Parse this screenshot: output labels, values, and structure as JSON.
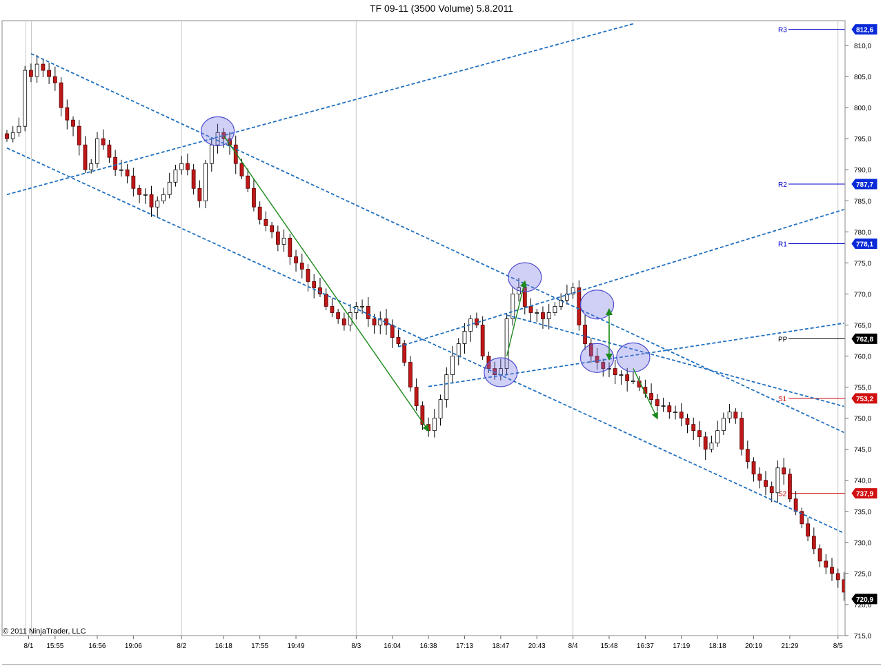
{
  "chart_data": {
    "type": "candlestick",
    "title": "TF 09-11 (3500 Volume)  5.8.2011",
    "copyright": "© 2011 NinjaTrader, LLC",
    "ylim": [
      715,
      814
    ],
    "y_ticks": [
      "715,0",
      "720,0",
      "725,0",
      "730,0",
      "735,0",
      "740,0",
      "745,0",
      "750,0",
      "755,0",
      "760,0",
      "765,0",
      "770,0",
      "775,0",
      "780,0",
      "785,0",
      "790,0",
      "795,0",
      "800,0",
      "805,0",
      "810,0"
    ],
    "y_tick_values": [
      715,
      720,
      725,
      730,
      735,
      740,
      745,
      750,
      755,
      760,
      765,
      770,
      775,
      780,
      785,
      790,
      795,
      800,
      805,
      810
    ],
    "x_labels": [
      "8/1",
      "15:55",
      "16:56",
      "19:06",
      "8/2",
      "16:18",
      "17:55",
      "19:49",
      "8/3",
      "16:04",
      "16:38",
      "17:13",
      "18:47",
      "20:43",
      "8/4",
      "15:48",
      "16:37",
      "17:19",
      "18:18",
      "20:19",
      "21:29",
      "8/5"
    ],
    "x_label_bars": [
      2,
      8,
      15,
      21,
      29,
      36,
      42,
      48,
      58,
      64,
      70,
      76,
      82,
      88,
      94,
      100,
      106,
      112,
      118,
      124,
      130,
      138
    ],
    "session_breaks": [
      2,
      29,
      58,
      94,
      138
    ],
    "bar_count": 140,
    "closes": [
      795,
      796,
      797,
      806,
      805,
      807,
      806,
      805,
      804,
      800,
      798,
      797,
      794,
      790,
      791,
      795,
      794,
      792,
      790,
      790,
      789,
      787,
      786,
      786,
      784,
      785,
      786,
      788,
      790,
      791,
      790,
      787,
      785,
      791,
      794,
      796,
      795,
      794,
      791,
      789,
      787,
      784,
      782,
      781,
      780,
      778,
      779,
      776,
      775,
      774,
      772,
      771,
      770,
      768,
      767,
      766,
      765,
      767,
      768,
      768,
      766,
      765,
      766,
      765,
      763,
      762,
      759,
      755,
      752,
      749,
      748,
      750,
      753,
      757,
      760,
      762,
      764,
      766,
      765,
      760,
      758,
      757,
      758,
      766,
      770,
      771,
      768,
      767,
      767,
      766,
      767,
      768,
      769,
      770,
      771,
      765,
      762,
      760,
      759,
      758,
      758,
      757,
      757,
      756,
      756,
      755,
      754,
      753,
      752,
      752,
      751,
      751,
      750,
      749,
      748,
      747,
      745,
      746,
      748,
      750,
      751,
      750,
      745,
      743,
      741,
      740,
      739,
      738,
      742,
      741,
      737,
      735,
      733,
      731,
      729,
      727,
      726,
      725,
      724,
      722
    ],
    "pivots": [
      {
        "label": "R3",
        "value": 812.6,
        "display": "812,6",
        "color": "#0000cc"
      },
      {
        "label": "R2",
        "value": 787.7,
        "display": "787,7",
        "color": "#0000cc"
      },
      {
        "label": "R1",
        "value": 778.1,
        "display": "778,1",
        "color": "#0000cc"
      },
      {
        "label": "PP",
        "value": 762.8,
        "display": "762,8",
        "color": "#000000"
      },
      {
        "label": "S1",
        "value": 753.2,
        "display": "753,2",
        "color": "#cc0000"
      },
      {
        "label": "S2",
        "value": 737.9,
        "display": "737,9",
        "color": "#cc0000"
      }
    ],
    "last_price": {
      "value": 720.9,
      "display": "720,9"
    },
    "trendlines": [
      {
        "from": [
          4,
          808.7
        ],
        "to": [
          139,
          747.7
        ]
      },
      {
        "from": [
          0,
          793.5
        ],
        "to": [
          139,
          731.5
        ]
      },
      {
        "from": [
          0,
          786.0
        ],
        "to": [
          104,
          813.5
        ]
      },
      {
        "from": [
          65,
          761.5
        ],
        "to": [
          139,
          783.6
        ]
      },
      {
        "from": [
          70,
          755.1
        ],
        "to": [
          139,
          765.3
        ]
      },
      {
        "from": [
          83,
          766.6
        ],
        "to": [
          139,
          751.9
        ]
      }
    ],
    "circles": [
      [
        35,
        796.2
      ],
      [
        86,
        772.7
      ],
      [
        82,
        757.4
      ],
      [
        98,
        768.3
      ],
      [
        98,
        759.7
      ],
      [
        104,
        759.8
      ]
    ],
    "arrows": [
      {
        "from": [
          36,
          795.5
        ],
        "to": [
          70,
          748.0
        ]
      },
      {
        "from": [
          83,
          760.0
        ],
        "to": [
          86,
          772.0
        ]
      },
      {
        "from": [
          100,
          762.0
        ],
        "to": [
          100,
          767.5
        ]
      },
      {
        "from": [
          100,
          765.0
        ],
        "to": [
          100,
          759.5
        ]
      },
      {
        "from": [
          104,
          758.0
        ],
        "to": [
          108,
          750.0
        ]
      }
    ]
  }
}
